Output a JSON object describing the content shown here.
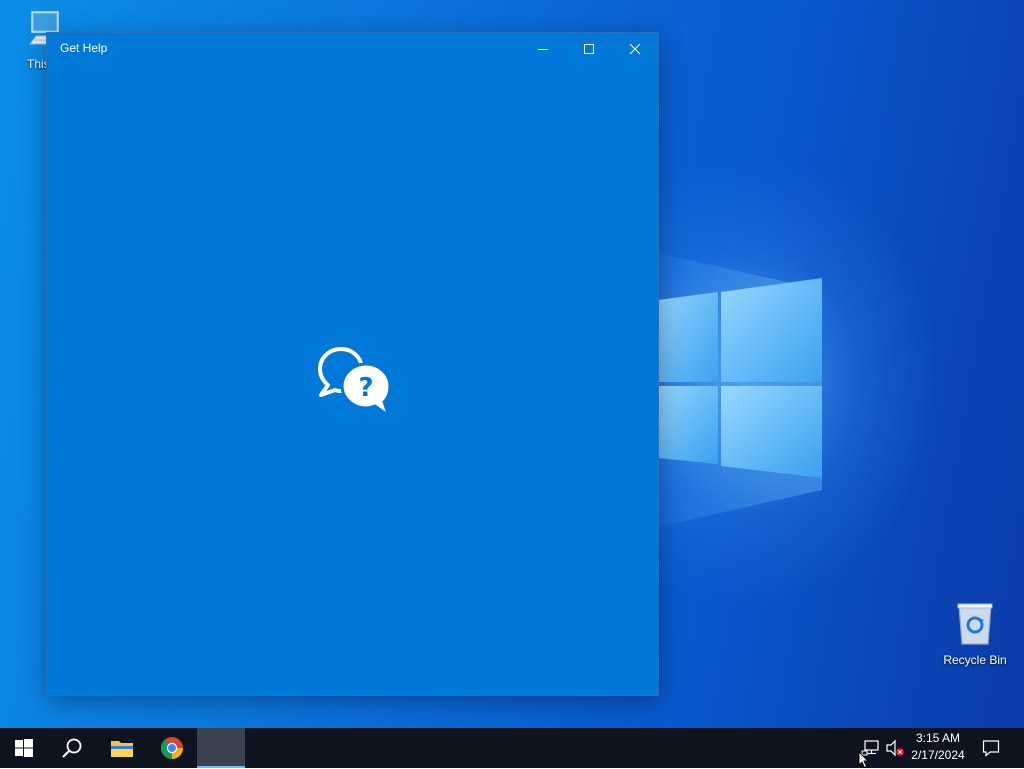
{
  "desktop": {
    "icons": [
      {
        "label": "This PC",
        "visible_label": "This P"
      },
      {
        "label": "Recycle Bin"
      }
    ]
  },
  "window": {
    "title": "Get Help",
    "app_bg_color": "#0078d7",
    "controls": [
      "minimize-icon",
      "maximize-icon",
      "close-icon"
    ],
    "splash_icon": "chat-help-icon"
  },
  "taskbar": {
    "pinned": [
      "start-icon",
      "search-icon",
      "file-explorer-icon",
      "chrome-icon",
      "get-help-app"
    ],
    "tray": {
      "network_icon": "network-icon",
      "volume_icon": "volume-muted-icon",
      "time": "3:15 AM",
      "date": "2/17/2024",
      "notification_icon": "action-center-icon"
    }
  }
}
